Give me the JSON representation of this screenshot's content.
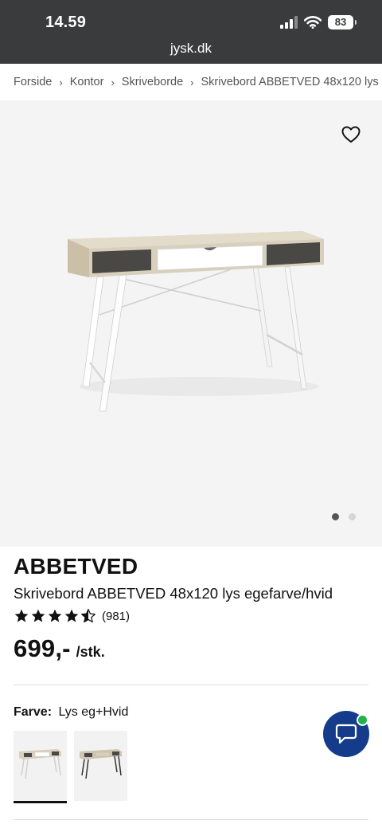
{
  "status_bar": {
    "time": "14.59",
    "battery": "83",
    "url": "jysk.dk"
  },
  "breadcrumb": [
    "Forside",
    "Kontor",
    "Skriveborde",
    "Skrivebord ABBETVED 48x120 lys"
  ],
  "gallery": {
    "favorite_icon": "heart-outline-icon",
    "image_count": 2,
    "active_image": 1
  },
  "product": {
    "brand": "ABBETVED",
    "name": "Skrivebord ABBETVED 48x120 lys egefarve/hvid",
    "rating_value": 4.5,
    "rating_max": 5,
    "review_count": "(981)",
    "price": "699,-",
    "price_unit": "/stk."
  },
  "color": {
    "label": "Farve:",
    "value": "Lys eg+Hvid",
    "swatches": [
      {
        "name": "Lys eg+Hvid",
        "selected": true
      },
      {
        "name": "Lys eg+Sort",
        "selected": false
      }
    ]
  },
  "chat": {
    "icon": "chat-bubble-icon",
    "status_color": "#22b14c"
  },
  "colors": {
    "status_bar": "#3a3b3c",
    "chat_button": "#143c8a",
    "gallery_bg": "#f4f4f4"
  }
}
